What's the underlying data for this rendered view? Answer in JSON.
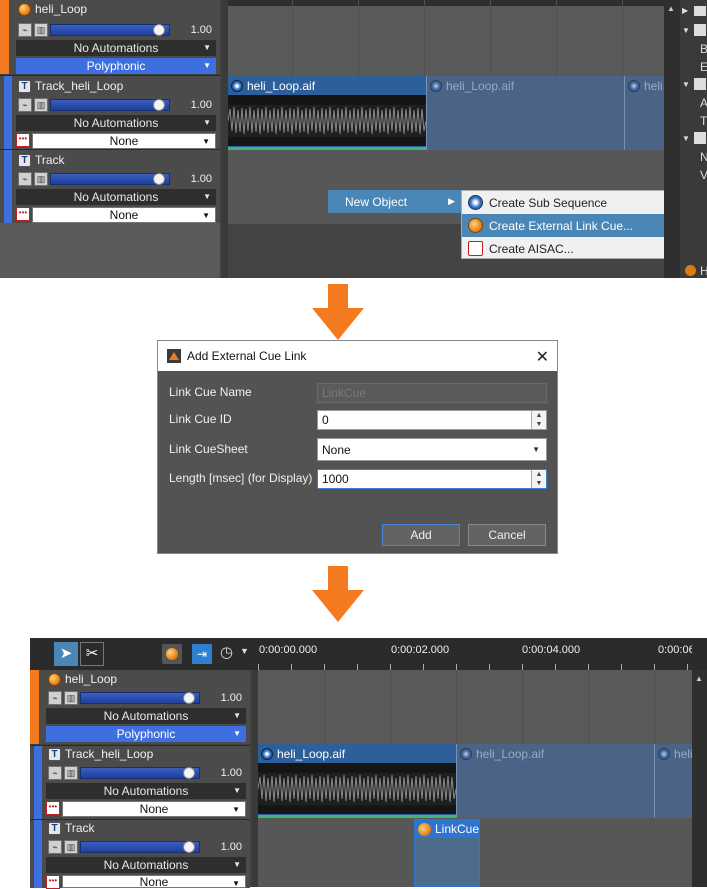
{
  "step1": {
    "tracks": [
      {
        "name": "heli_Loop",
        "volume": "1.00",
        "volume_fraction": 0.88,
        "automation": "No Automations",
        "mode": "Polyphonic",
        "mode_style": "blue"
      },
      {
        "name": "Track_heli_Loop",
        "volume": "1.00",
        "volume_fraction": 0.88,
        "automation": "No Automations",
        "mode": "None",
        "mode_style": "white"
      },
      {
        "name": "Track",
        "volume": "1.00",
        "volume_fraction": 0.88,
        "automation": "No Automations",
        "mode": "None",
        "mode_style": "white"
      }
    ],
    "clips": [
      "heli_Loop.aif",
      "heli_Loop.aif",
      "heli"
    ],
    "context_menu": {
      "submenu_label": "New Object",
      "items": [
        {
          "label": "Create Sub Sequence",
          "icon": "sub-sequence-icon",
          "selected": false
        },
        {
          "label": "Create External Link Cue...",
          "icon": "link-cue-icon",
          "selected": true
        },
        {
          "label": "Create AISAC...",
          "icon": "aisac-icon",
          "selected": false
        }
      ]
    },
    "right_panel_letters": [
      "B",
      "E",
      "A",
      "T",
      "N",
      "V",
      "H"
    ]
  },
  "dialog": {
    "title": "Add External Cue Link",
    "fields": [
      {
        "label": "Link Cue Name",
        "value": "",
        "placeholder": "LinkCue",
        "type": "text-disabled"
      },
      {
        "label": "Link Cue ID",
        "value": "0",
        "type": "spin"
      },
      {
        "label": "Link CueSheet",
        "value": "None",
        "type": "select"
      },
      {
        "label": "Length [msec] (for Display)",
        "value": "1000",
        "type": "spin"
      }
    ],
    "add_label": "Add",
    "cancel_label": "Cancel"
  },
  "step3": {
    "ruler": [
      "0:00:00.000",
      "0:00:02.000",
      "0:00:04.000",
      "0:00:06"
    ],
    "tracks": [
      {
        "name": "heli_Loop",
        "volume": "1.00",
        "volume_fraction": 0.88,
        "automation": "No Automations",
        "mode": "Polyphonic",
        "mode_style": "blue"
      },
      {
        "name": "Track_heli_Loop",
        "volume": "1.00",
        "volume_fraction": 0.88,
        "automation": "No Automations",
        "mode": "None",
        "mode_style": "white"
      },
      {
        "name": "Track",
        "volume": "1.00",
        "volume_fraction": 0.88,
        "automation": "No Automations",
        "mode": "None",
        "mode_style": "white"
      }
    ],
    "clips": [
      "heli_Loop.aif",
      "heli_Loop.aif",
      "heli"
    ],
    "link_cue_label": "LinkCue"
  },
  "colors": {
    "accent_orange": "#f47a20",
    "track_blue": "#3d6fe0",
    "selection_blue": "#4a86b6",
    "panel_dark": "#3f3f3f"
  }
}
